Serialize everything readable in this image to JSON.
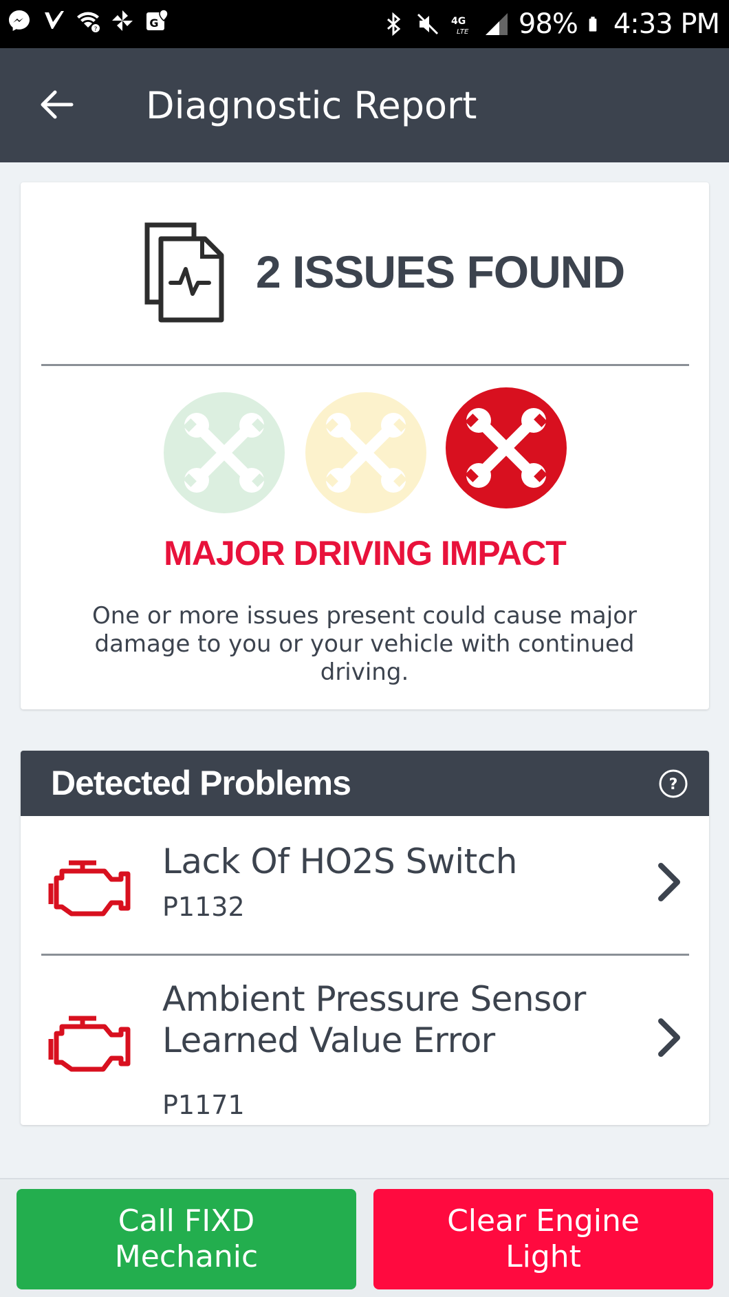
{
  "status_bar": {
    "battery": "98%",
    "time": "4:33 PM",
    "network": "4G LTE",
    "icons_left": [
      "messenger-icon",
      "inbox-check-icon",
      "wifi-question-icon",
      "pinwheel-icon",
      "maps-icon"
    ],
    "icons_right": [
      "bluetooth-icon",
      "mute-icon",
      "lte-icon",
      "signal-icon",
      "battery-icon"
    ]
  },
  "app_bar": {
    "title": "Diagnostic Report",
    "back_icon": "arrow-left-icon"
  },
  "summary": {
    "issues_text": "2 ISSUES FOUND",
    "impact_label": "MAJOR DRIVING IMPACT",
    "impact_description": "One or more issues present could cause major damage to you or your vehicle with continued driving.",
    "severity_levels": [
      {
        "level": "minor",
        "active": false,
        "color": "#dcefe0"
      },
      {
        "level": "moderate",
        "active": false,
        "color": "#fcf2cc"
      },
      {
        "level": "major",
        "active": true,
        "color": "#d8101f"
      }
    ],
    "impact_color": "#e8123b"
  },
  "problems": {
    "title": "Detected Problems",
    "items": [
      {
        "name": "Lack Of HO2S Switch",
        "code": "P1132"
      },
      {
        "name": "Ambient Pressure Sensor Learned Value Error",
        "code": "P1171"
      }
    ]
  },
  "actions": {
    "call_mechanic": {
      "line1": "Call FIXD",
      "line2": "Mechanic",
      "color": "#23ae4e"
    },
    "clear_light": {
      "line1": "Clear Engine",
      "line2": "Light",
      "color": "#ff0a3f"
    }
  }
}
